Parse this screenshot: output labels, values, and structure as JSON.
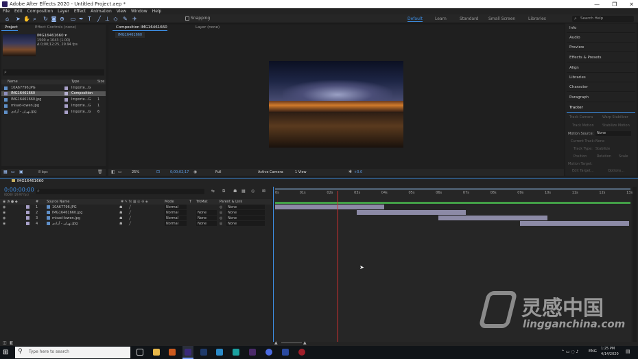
{
  "window": {
    "title": "Adobe After Effects 2020 - Untitled Project.aep *",
    "controls": [
      "—",
      "❐",
      "✕"
    ]
  },
  "menu": [
    "File",
    "Edit",
    "Composition",
    "Layer",
    "Effect",
    "Animation",
    "View",
    "Window",
    "Help"
  ],
  "toolbar": {
    "snapping": "Snapping",
    "workspaces": [
      "Default",
      "Learn",
      "Standard",
      "Small Screen",
      "Libraries"
    ],
    "search_placeholder": "Search Help"
  },
  "project_panel": {
    "tab_project": "Project",
    "tab_effect_controls": "Effect Controls (none)",
    "selected_name": "IMG16461660 ▾",
    "selected_info1": "1500 x 1043 (1.00)",
    "selected_info2": "Δ 0;00;12;25, 29.94 fps",
    "columns": [
      "Name",
      "Type",
      "Size"
    ],
    "items": [
      {
        "name": "10A67796.JPG",
        "type": "Importe...G",
        "size": ""
      },
      {
        "name": "IMG16461660",
        "type": "Composition",
        "size": ""
      },
      {
        "name": "IMG16461660.jpg",
        "type": "Importe...G",
        "size": "1"
      },
      {
        "name": "misad-lowen.jpg",
        "type": "Importe...G",
        "size": "1"
      },
      {
        "name": "تهران - آزادی.jpg",
        "type": "Importe...G",
        "size": "6"
      }
    ],
    "bit_depth": "8 bpc"
  },
  "comp_panel": {
    "tab_comp": "Composition IMG16461660",
    "tab_layer": "Layer (none)",
    "subtab": "IMG16461660",
    "zoom": "25%",
    "timecode": "0;00;02;17",
    "quality": "Full",
    "camera": "Active Camera",
    "views": "1 View",
    "exposure": "+0.0"
  },
  "right_panel": {
    "items": [
      "Info",
      "Audio",
      "Preview",
      "Effects & Presets",
      "Align",
      "Libraries",
      "Character",
      "Paragraph",
      "Tracker"
    ],
    "tracker": {
      "buttons": [
        "Track Camera",
        "Warp Stabilizer",
        "Track Motion",
        "Stabilize Motion"
      ],
      "motion_source_label": "Motion Source:",
      "motion_source_value": "None",
      "current_track_label": "Current Track:",
      "current_track_value": "None",
      "track_type_label": "Track Type:",
      "track_type_value": "Stabilize",
      "options": [
        "Position",
        "Rotation",
        "Scale"
      ],
      "motion_target": "Motion Target:",
      "bottom_buttons": [
        "Edit Target...",
        "Options..."
      ]
    }
  },
  "timeline": {
    "tab": "IMG16461660",
    "timecode": "0:00:00:00",
    "fps": "00000 (29.97 fps)",
    "columns": [
      "#",
      "Source Name",
      "Mode",
      "T",
      "TrkMat",
      "Parent & Link"
    ],
    "layers": [
      {
        "num": "1",
        "name": "10A67796.JPG",
        "mode": "Normal",
        "trkmat": "",
        "parent": "None"
      },
      {
        "num": "2",
        "name": "IMG16461660.jpg",
        "mode": "Normal",
        "trkmat": "None",
        "parent": "None"
      },
      {
        "num": "3",
        "name": "misad-lowen.jpg",
        "mode": "Normal",
        "trkmat": "None",
        "parent": "None"
      },
      {
        "num": "4",
        "name": "تهران - آزادی.jpg",
        "mode": "Normal",
        "trkmat": "None",
        "parent": "None"
      }
    ],
    "ruler": [
      "0s",
      "01s",
      "02s",
      "03s",
      "04s",
      "05s",
      "06s",
      "07s",
      "08s",
      "09s",
      "10s",
      "11s",
      "12s",
      "13s"
    ],
    "bars": [
      {
        "start": 0.0,
        "end": 4.0
      },
      {
        "start": 3.0,
        "end": 7.0
      },
      {
        "start": 6.0,
        "end": 10.0
      },
      {
        "start": 9.0,
        "end": 13.0
      }
    ],
    "playhead_seconds": 2.3,
    "watermark_cn": "灵感中国",
    "watermark_en": "lingganchina.com"
  },
  "taskbar": {
    "search_placeholder": "Type here to search",
    "tray_lang": "ENG",
    "time": "1:25 PM",
    "date": "4/14/2020"
  },
  "colors": {
    "accent": "#3d8fe6",
    "bar": "#8c8aa6",
    "workarea": "#43a047",
    "playhead": "#d32f2f"
  }
}
